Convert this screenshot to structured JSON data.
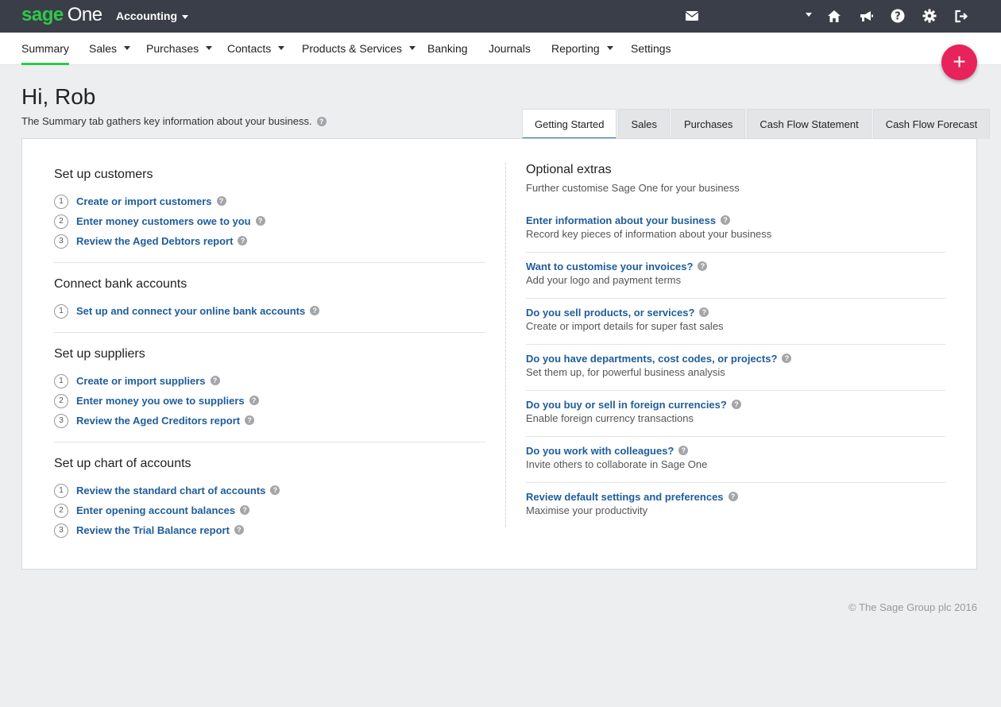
{
  "brand": {
    "sage": "sage",
    "one": "One"
  },
  "app_switcher": {
    "label": "Accounting"
  },
  "topbar_icons": [
    "mail-icon",
    "home-icon",
    "megaphone-icon",
    "help-icon",
    "gear-icon",
    "logout-icon"
  ],
  "nav": {
    "items": [
      {
        "label": "Summary",
        "active": true,
        "dropdown": false
      },
      {
        "label": "Sales",
        "dropdown": true
      },
      {
        "label": "Purchases",
        "dropdown": true
      },
      {
        "label": "Contacts",
        "dropdown": true
      },
      {
        "label": "Products & Services",
        "dropdown": true
      },
      {
        "label": "Banking",
        "dropdown": false
      },
      {
        "label": "Journals",
        "dropdown": false
      },
      {
        "label": "Reporting",
        "dropdown": true
      },
      {
        "label": "Settings",
        "dropdown": false
      }
    ]
  },
  "fab": {
    "label": "+"
  },
  "page": {
    "greeting": "Hi, Rob",
    "subtitle": "The Summary tab gathers key information about your business."
  },
  "tabs": [
    {
      "label": "Getting Started",
      "active": true
    },
    {
      "label": "Sales"
    },
    {
      "label": "Purchases"
    },
    {
      "label": "Cash Flow Statement"
    },
    {
      "label": "Cash Flow Forecast"
    }
  ],
  "setup_sections": [
    {
      "title": "Set up customers",
      "steps": [
        {
          "num": "1",
          "label": "Create or import customers"
        },
        {
          "num": "2",
          "label": "Enter money customers owe to you"
        },
        {
          "num": "3",
          "label": "Review the Aged Debtors report"
        }
      ]
    },
    {
      "title": "Connect bank accounts",
      "steps": [
        {
          "num": "1",
          "label": "Set up and connect your online bank accounts"
        }
      ]
    },
    {
      "title": "Set up suppliers",
      "steps": [
        {
          "num": "1",
          "label": "Create or import suppliers"
        },
        {
          "num": "2",
          "label": "Enter money you owe to suppliers"
        },
        {
          "num": "3",
          "label": "Review the Aged Creditors report"
        }
      ]
    },
    {
      "title": "Set up chart of accounts",
      "steps": [
        {
          "num": "1",
          "label": "Review the standard chart of accounts"
        },
        {
          "num": "2",
          "label": "Enter opening account balances"
        },
        {
          "num": "3",
          "label": "Review the Trial Balance report"
        }
      ]
    }
  ],
  "extras": {
    "title": "Optional extras",
    "subtitle": "Further customise Sage One for your business",
    "items": [
      {
        "label": "Enter information about your business",
        "desc": "Record key pieces of information about your business"
      },
      {
        "label": "Want to customise your invoices?",
        "desc": "Add your logo and payment terms"
      },
      {
        "label": "Do you sell products, or services?",
        "desc": "Create or import details for super fast sales"
      },
      {
        "label": "Do you have departments, cost codes, or projects?",
        "desc": "Set them up, for powerful business analysis"
      },
      {
        "label": "Do you buy or sell in foreign currencies?",
        "desc": "Enable foreign currency transactions"
      },
      {
        "label": "Do you work with colleagues?",
        "desc": "Invite others to collaborate in Sage One"
      },
      {
        "label": "Review default settings and preferences",
        "desc": "Maximise your productivity"
      }
    ]
  },
  "footer": {
    "copyright": "© The Sage Group plc 2016"
  }
}
